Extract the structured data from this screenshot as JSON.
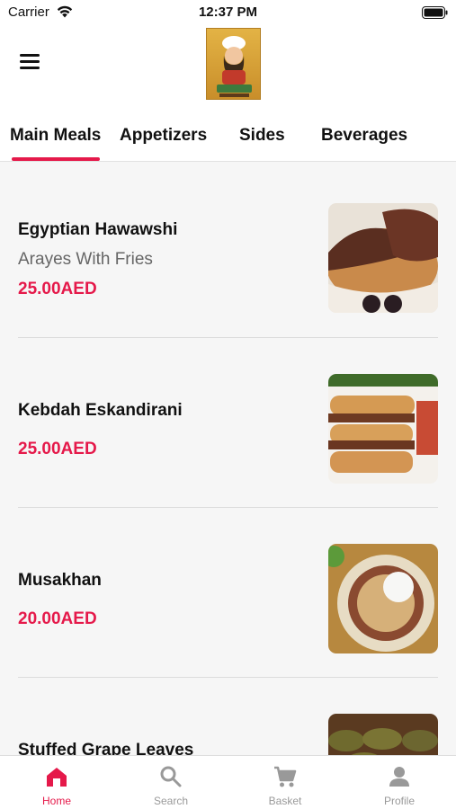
{
  "status_bar": {
    "carrier": "Carrier",
    "time": "12:37 PM"
  },
  "header": {
    "menu_icon": "hamburger-menu-icon",
    "logo_name": "restaurant-logo"
  },
  "tabs": [
    {
      "label": "Main Meals",
      "active": true
    },
    {
      "label": "Appetizers",
      "active": false
    },
    {
      "label": "Sides",
      "active": false
    },
    {
      "label": "Beverages",
      "active": false
    }
  ],
  "menu_items": [
    {
      "title": "Egyptian Hawawshi",
      "subtitle": "Arayes With Fries",
      "price": "25.00AED",
      "image": "hawawshi-photo"
    },
    {
      "title": "Kebdah Eskandirani",
      "subtitle": "",
      "price": "25.00AED",
      "image": "kebdah-sandwich-photo"
    },
    {
      "title": "Musakhan",
      "subtitle": "",
      "price": "20.00AED",
      "image": "musakhan-platter-photo"
    },
    {
      "title": "Stuffed Grape Leaves",
      "subtitle": "",
      "price": "",
      "image": "grape-leaves-photo"
    }
  ],
  "tab_bar": [
    {
      "label": "Home",
      "icon": "home-icon",
      "active": true
    },
    {
      "label": "Search",
      "icon": "search-icon",
      "active": false
    },
    {
      "label": "Basket",
      "icon": "cart-icon",
      "active": false
    },
    {
      "label": "Profile",
      "icon": "person-icon",
      "active": false
    }
  ],
  "colors": {
    "accent": "#e5194a",
    "inactive": "#999999",
    "background": "#f6f6f6"
  }
}
